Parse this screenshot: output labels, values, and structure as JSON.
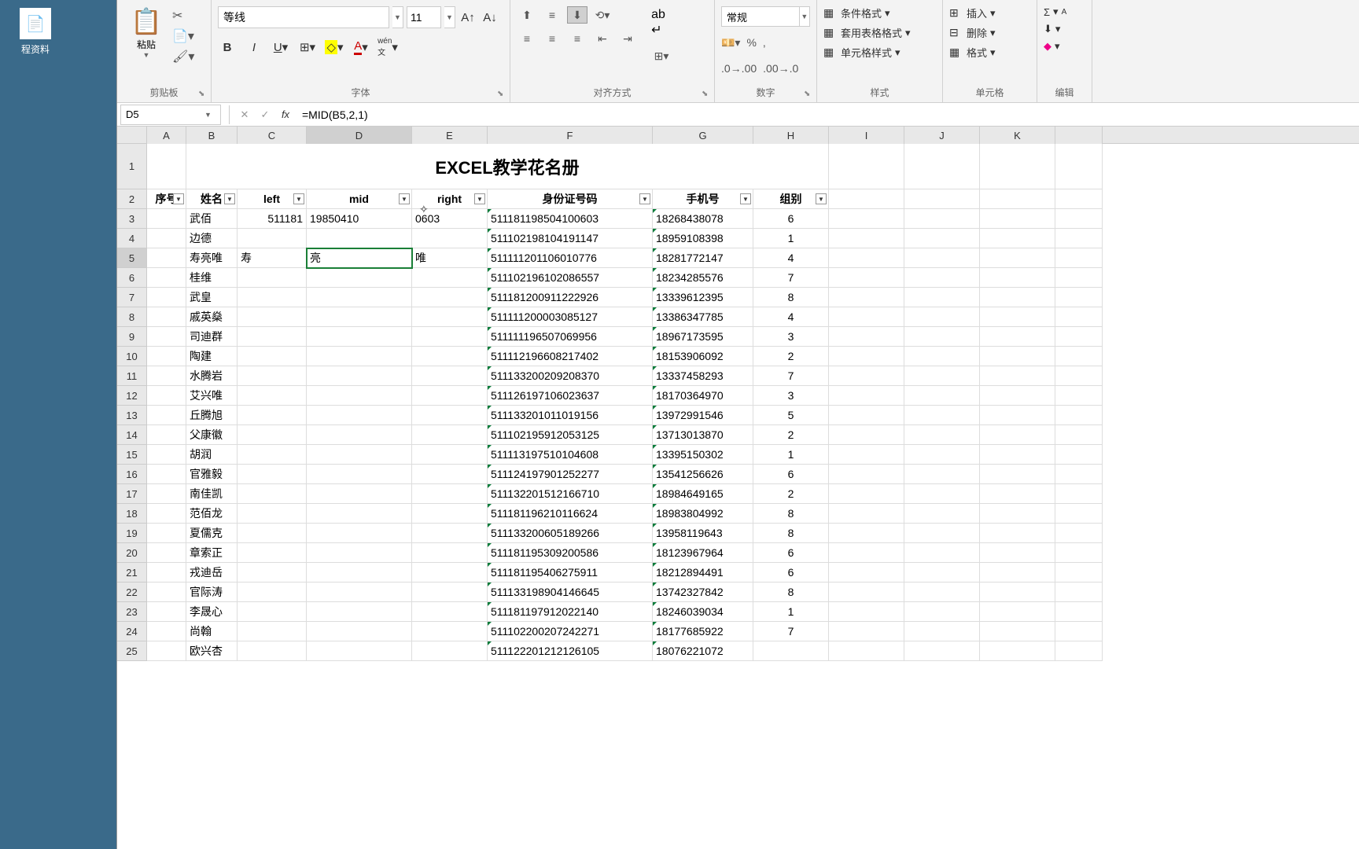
{
  "desktop": {
    "folder_label": "程资料"
  },
  "ribbon": {
    "clipboard": {
      "paste": "粘贴",
      "group": "剪贴板"
    },
    "font": {
      "name": "等线",
      "size": "11",
      "group": "字体"
    },
    "align": {
      "group": "对齐方式"
    },
    "number": {
      "format": "常规",
      "group": "数字"
    },
    "styles": {
      "cond": "条件格式",
      "table": "套用表格格式",
      "cell": "单元格样式",
      "group": "样式"
    },
    "cells": {
      "insert": "插入",
      "delete": "删除",
      "format": "格式",
      "group": "单元格"
    },
    "edit": {
      "group": "编辑"
    }
  },
  "formula_bar": {
    "name_box": "D5",
    "formula": "=MID(B5,2,1)"
  },
  "columns": [
    "A",
    "B",
    "C",
    "D",
    "E",
    "F",
    "G",
    "H",
    "I",
    "J",
    "K",
    ""
  ],
  "title": "EXCEL教学花名册",
  "headers": {
    "A": "序号",
    "B": "姓名",
    "C": "left",
    "D": "mid",
    "E": "right",
    "F": "身份证号码",
    "G": "手机号",
    "H": "组别"
  },
  "rows": [
    {
      "n": 3,
      "B": "武佰",
      "C": "511181",
      "D": "19850410",
      "E": "0603",
      "F": "511181198504100603",
      "G": "18268438078",
      "H": "6"
    },
    {
      "n": 4,
      "B": "边德",
      "C": "",
      "D": "",
      "E": "",
      "F": "511102198104191147",
      "G": "18959108398",
      "H": "1"
    },
    {
      "n": 5,
      "B": "寿亮唯",
      "C": "寿",
      "D": "亮",
      "E": "唯",
      "F": "511111201106010776",
      "G": "18281772147",
      "H": "4"
    },
    {
      "n": 6,
      "B": "桂维",
      "C": "",
      "D": "",
      "E": "",
      "F": "511102196102086557",
      "G": "18234285576",
      "H": "7"
    },
    {
      "n": 7,
      "B": "武皇",
      "C": "",
      "D": "",
      "E": "",
      "F": "511181200911222926",
      "G": "13339612395",
      "H": "8"
    },
    {
      "n": 8,
      "B": "戚英燊",
      "C": "",
      "D": "",
      "E": "",
      "F": "511111200003085127",
      "G": "13386347785",
      "H": "4"
    },
    {
      "n": 9,
      "B": "司迪群",
      "C": "",
      "D": "",
      "E": "",
      "F": "511111196507069956",
      "G": "18967173595",
      "H": "3"
    },
    {
      "n": 10,
      "B": "陶建",
      "C": "",
      "D": "",
      "E": "",
      "F": "511112196608217402",
      "G": "18153906092",
      "H": "2"
    },
    {
      "n": 11,
      "B": "水腾岩",
      "C": "",
      "D": "",
      "E": "",
      "F": "511133200209208370",
      "G": "13337458293",
      "H": "7"
    },
    {
      "n": 12,
      "B": "艾兴唯",
      "C": "",
      "D": "",
      "E": "",
      "F": "511126197106023637",
      "G": "18170364970",
      "H": "3"
    },
    {
      "n": 13,
      "B": "丘腾旭",
      "C": "",
      "D": "",
      "E": "",
      "F": "511133201011019156",
      "G": "13972991546",
      "H": "5"
    },
    {
      "n": 14,
      "B": "父康徽",
      "C": "",
      "D": "",
      "E": "",
      "F": "511102195912053125",
      "G": "13713013870",
      "H": "2"
    },
    {
      "n": 15,
      "B": "胡润",
      "C": "",
      "D": "",
      "E": "",
      "F": "511113197510104608",
      "G": "13395150302",
      "H": "1"
    },
    {
      "n": 16,
      "B": "官雅毅",
      "C": "",
      "D": "",
      "E": "",
      "F": "511124197901252277",
      "G": "13541256626",
      "H": "6"
    },
    {
      "n": 17,
      "B": "南佳凯",
      "C": "",
      "D": "",
      "E": "",
      "F": "511132201512166710",
      "G": "18984649165",
      "H": "2"
    },
    {
      "n": 18,
      "B": "范佰龙",
      "C": "",
      "D": "",
      "E": "",
      "F": "511181196210116624",
      "G": "18983804992",
      "H": "8"
    },
    {
      "n": 19,
      "B": "夏儒克",
      "C": "",
      "D": "",
      "E": "",
      "F": "511133200605189266",
      "G": "13958119643",
      "H": "8"
    },
    {
      "n": 20,
      "B": "章索正",
      "C": "",
      "D": "",
      "E": "",
      "F": "511181195309200586",
      "G": "18123967964",
      "H": "6"
    },
    {
      "n": 21,
      "B": "戎迪岳",
      "C": "",
      "D": "",
      "E": "",
      "F": "511181195406275911",
      "G": "18212894491",
      "H": "6"
    },
    {
      "n": 22,
      "B": "官际涛",
      "C": "",
      "D": "",
      "E": "",
      "F": "511133198904146645",
      "G": "13742327842",
      "H": "8"
    },
    {
      "n": 23,
      "B": "李晟心",
      "C": "",
      "D": "",
      "E": "",
      "F": "511181197912022140",
      "G": "18246039034",
      "H": "1"
    },
    {
      "n": 24,
      "B": "尚翰",
      "C": "",
      "D": "",
      "E": "",
      "F": "511102200207242271",
      "G": "18177685922",
      "H": "7"
    },
    {
      "n": 25,
      "B": "欧兴杏",
      "C": "",
      "D": "",
      "E": "",
      "F": "511122201212126105",
      "G": "18076221072",
      "H": ""
    }
  ],
  "selected": {
    "row": 5,
    "col": "D"
  }
}
